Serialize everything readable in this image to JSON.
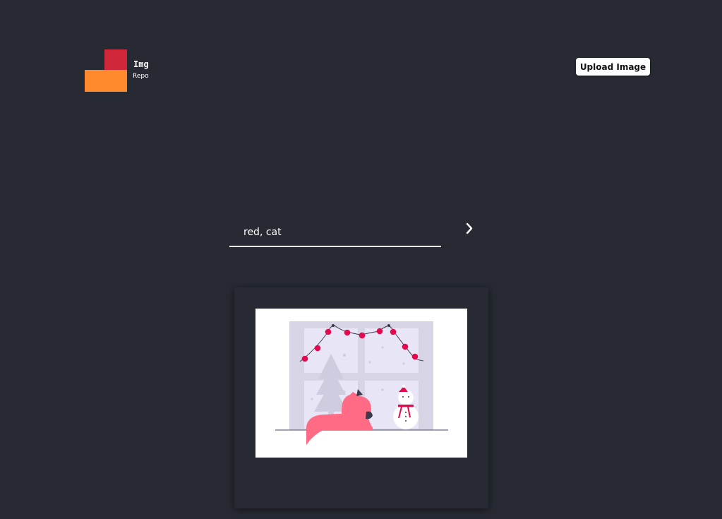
{
  "header": {
    "logo": {
      "title": "Img",
      "subtitle": "Repo",
      "colors": {
        "top_block": "#d0283a",
        "bottom_block": "#ff8a2e"
      }
    },
    "upload_button_label": "Upload Image"
  },
  "search": {
    "value": "red, cat",
    "submit_icon": "chevron-right-icon"
  },
  "results": [
    {
      "image": "cat-at-winter-window-illustration"
    }
  ],
  "colors": {
    "background": "#272a33",
    "accent": "#ff6a84",
    "card": "#272a33"
  }
}
